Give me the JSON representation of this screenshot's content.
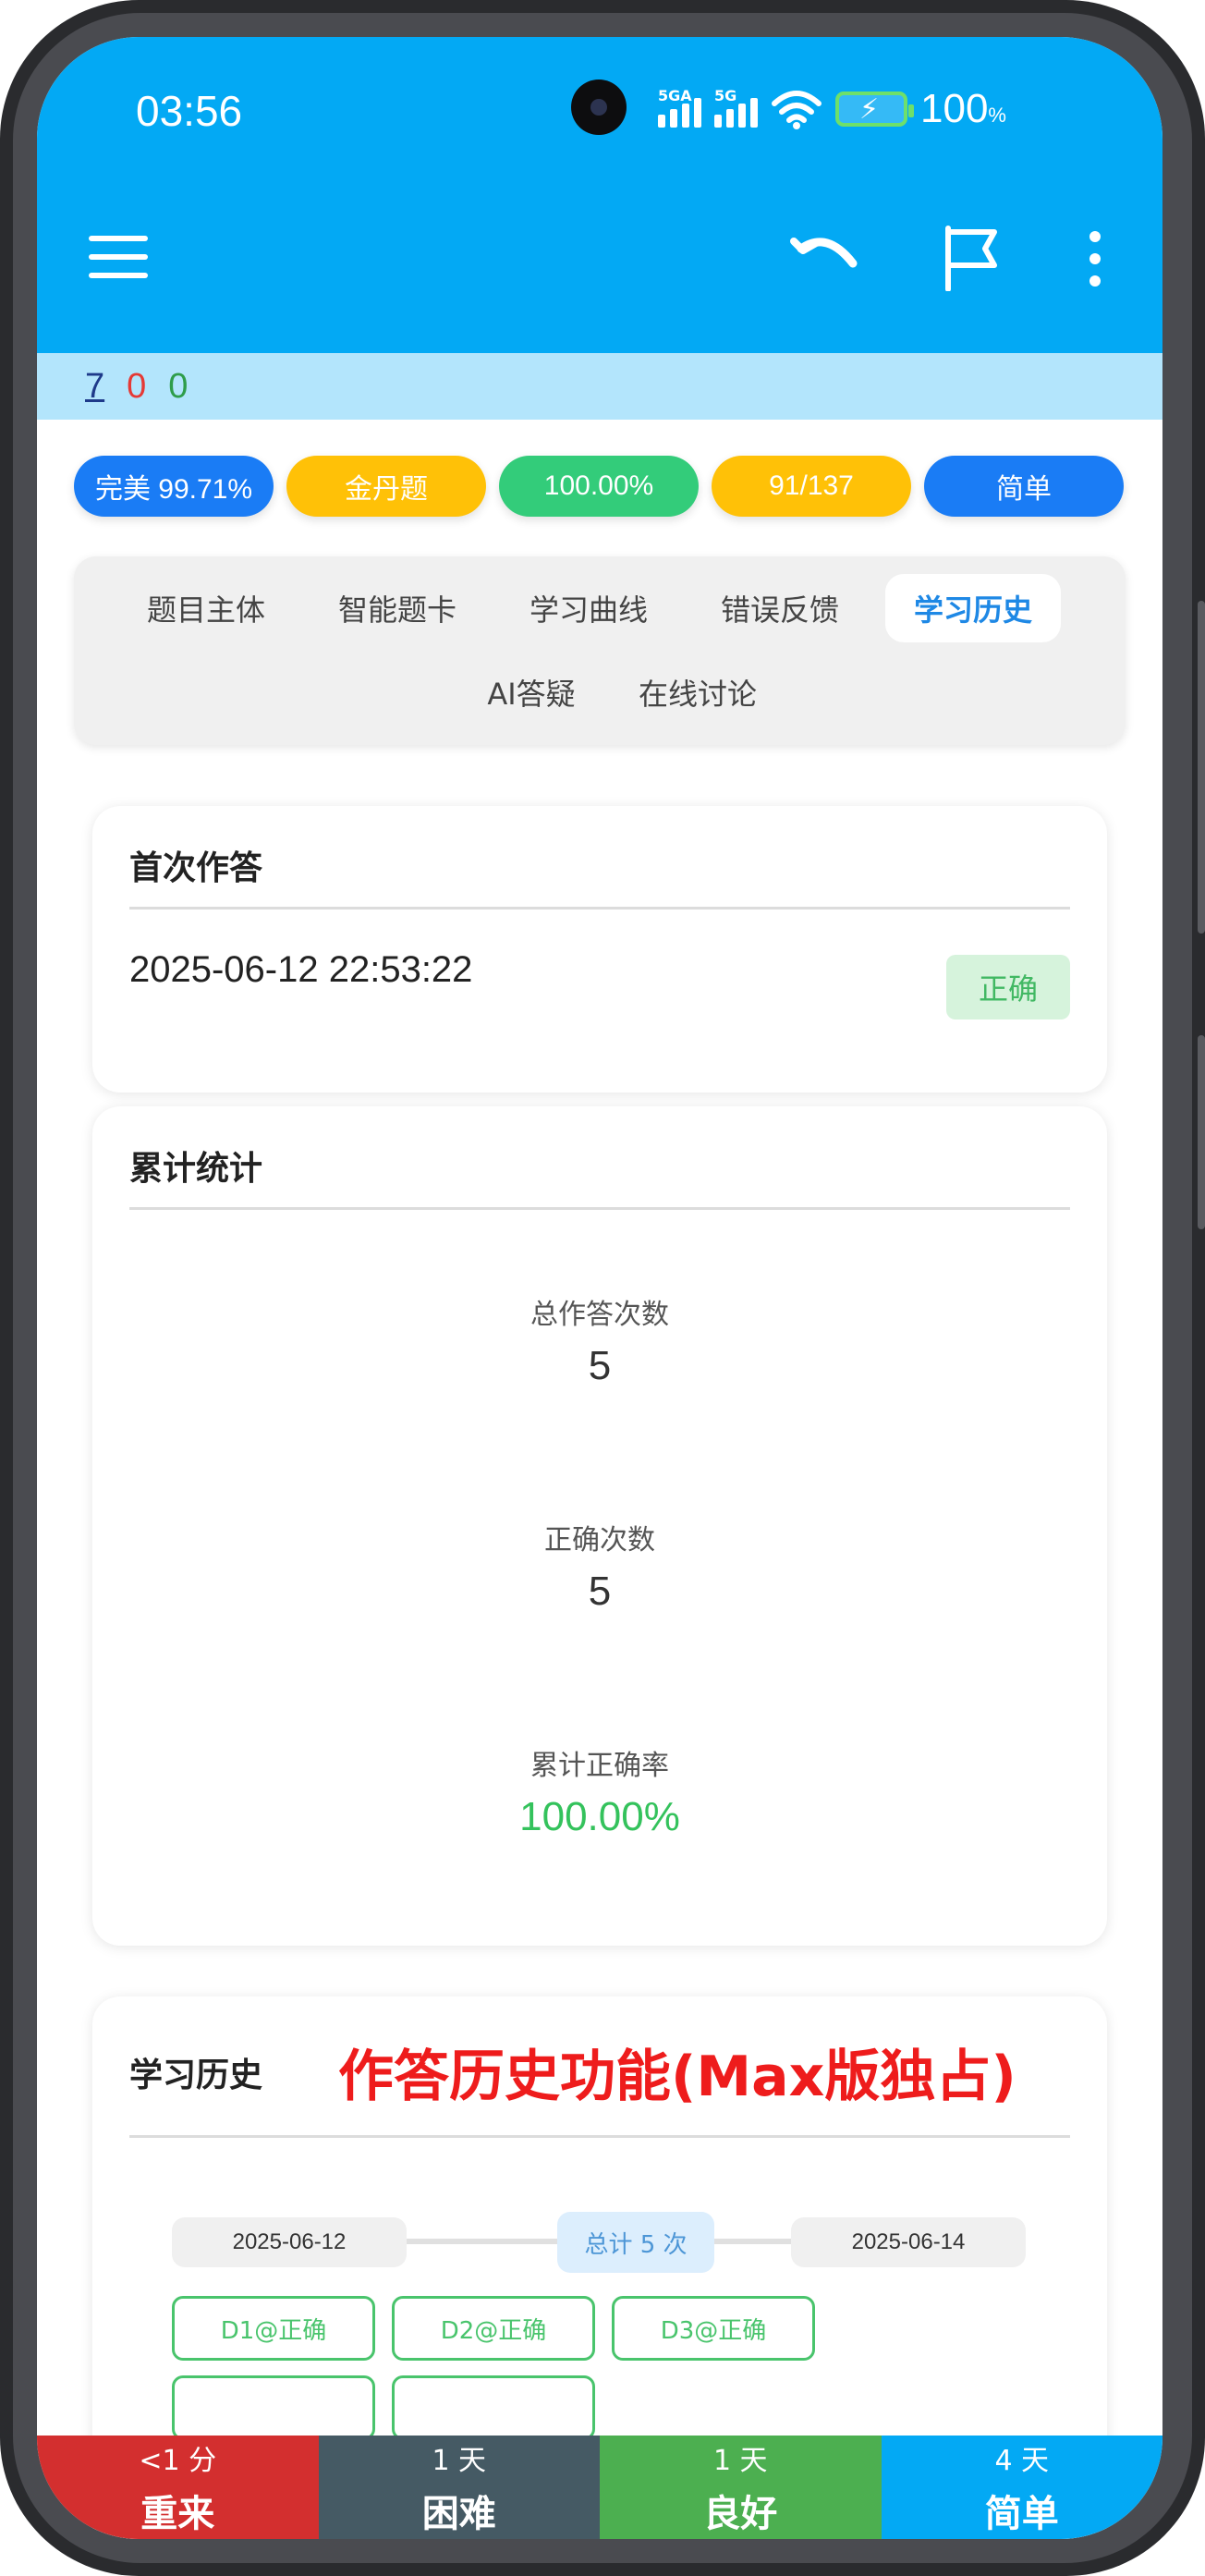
{
  "status_bar": {
    "time": "03:56",
    "network_1": "5GA",
    "network_2": "5G",
    "battery": "100",
    "battery_unit": "%"
  },
  "toolbar": {
    "icons": [
      "menu-icon",
      "undo-icon",
      "flag-icon",
      "more-vertical-icon"
    ]
  },
  "counts": {
    "blue": "7",
    "red": "0",
    "green": "0"
  },
  "badges": [
    {
      "label": "完美 99.71%",
      "color": "#1a7cf5"
    },
    {
      "label": "金丹题",
      "color": "#ffc107"
    },
    {
      "label": "100.00%",
      "color": "#33cc7a"
    },
    {
      "label": "91/137",
      "color": "#ffc107"
    },
    {
      "label": "简单",
      "color": "#1a7cf5"
    }
  ],
  "tabs": [
    {
      "label": "题目主体",
      "active": false
    },
    {
      "label": "智能题卡",
      "active": false
    },
    {
      "label": "学习曲线",
      "active": false
    },
    {
      "label": "错误反馈",
      "active": false
    },
    {
      "label": "学习历史",
      "active": true
    },
    {
      "label": "AI答疑",
      "active": false
    },
    {
      "label": "在线讨论",
      "active": false
    }
  ],
  "first_answer": {
    "title": "首次作答",
    "datetime": "2025-06-12 22:53:22",
    "result": "正确"
  },
  "stats": {
    "title": "累计统计",
    "total_label": "总作答次数",
    "total_value": "5",
    "correct_label": "正确次数",
    "correct_value": "5",
    "rate_label": "累计正确率",
    "rate_value": "100.00%"
  },
  "history": {
    "title": "学习历史",
    "promo": "作答历史功能(Max版独占)",
    "start_date": "2025-06-12",
    "end_date": "2025-06-14",
    "total": "总计 5 次",
    "chips": [
      "D1@正确",
      "D2@正确",
      "D3@正确"
    ]
  },
  "rating": [
    {
      "time": "<1 分",
      "label": "重来",
      "color": "#d32f2f"
    },
    {
      "time": "1 天",
      "label": "困难",
      "color": "#455a64"
    },
    {
      "time": "1 天",
      "label": "良好",
      "color": "#4caf50"
    },
    {
      "time": "4 天",
      "label": "简单",
      "color": "#03a9f4"
    }
  ]
}
